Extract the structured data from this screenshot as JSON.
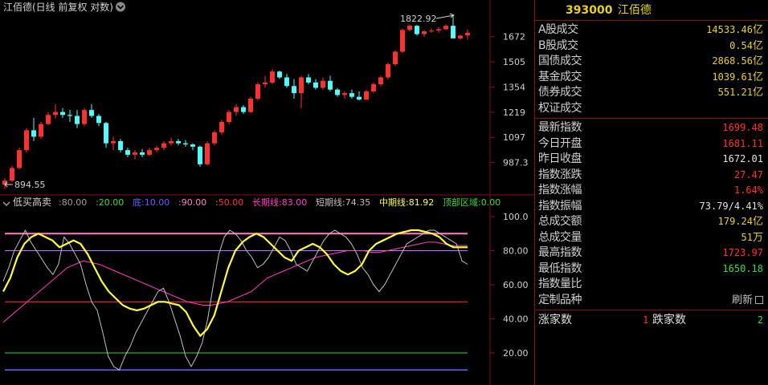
{
  "header": {
    "title": "江佰德(日线 前复权 对数)",
    "code": "393000",
    "name": "江佰德"
  },
  "main_chart": {
    "y_ticks": [
      "1672",
      "1505",
      "1354",
      "1219",
      "1097",
      "987.3"
    ],
    "max_label": "1822.92",
    "min_label": "894.55",
    "colors": {
      "up": "#ff3232",
      "down": "#54fcfc"
    },
    "candles": [
      {
        "o": 900,
        "h": 925,
        "l": 885,
        "c": 915
      },
      {
        "o": 915,
        "h": 975,
        "l": 910,
        "c": 965
      },
      {
        "o": 965,
        "h": 1050,
        "l": 960,
        "c": 1040
      },
      {
        "o": 1040,
        "h": 1140,
        "l": 1030,
        "c": 1130
      },
      {
        "o": 1130,
        "h": 1190,
        "l": 1080,
        "c": 1100
      },
      {
        "o": 1100,
        "h": 1170,
        "l": 1090,
        "c": 1160
      },
      {
        "o": 1160,
        "h": 1220,
        "l": 1155,
        "c": 1205
      },
      {
        "o": 1205,
        "h": 1260,
        "l": 1185,
        "c": 1220
      },
      {
        "o": 1220,
        "h": 1240,
        "l": 1190,
        "c": 1205
      },
      {
        "o": 1205,
        "h": 1230,
        "l": 1170,
        "c": 1200
      },
      {
        "o": 1200,
        "h": 1230,
        "l": 1140,
        "c": 1160
      },
      {
        "o": 1160,
        "h": 1240,
        "l": 1150,
        "c": 1230
      },
      {
        "o": 1230,
        "h": 1260,
        "l": 1190,
        "c": 1200
      },
      {
        "o": 1200,
        "h": 1210,
        "l": 1150,
        "c": 1165
      },
      {
        "o": 1165,
        "h": 1170,
        "l": 1050,
        "c": 1070
      },
      {
        "o": 1070,
        "h": 1100,
        "l": 1040,
        "c": 1080
      },
      {
        "o": 1080,
        "h": 1090,
        "l": 1030,
        "c": 1040
      },
      {
        "o": 1040,
        "h": 1050,
        "l": 1010,
        "c": 1020
      },
      {
        "o": 1020,
        "h": 1040,
        "l": 1000,
        "c": 1030
      },
      {
        "o": 1030,
        "h": 1045,
        "l": 1010,
        "c": 1020
      },
      {
        "o": 1020,
        "h": 1050,
        "l": 1015,
        "c": 1040
      },
      {
        "o": 1040,
        "h": 1060,
        "l": 1030,
        "c": 1050
      },
      {
        "o": 1050,
        "h": 1080,
        "l": 1040,
        "c": 1070
      },
      {
        "o": 1070,
        "h": 1095,
        "l": 1060,
        "c": 1080
      },
      {
        "o": 1080,
        "h": 1090,
        "l": 1060,
        "c": 1070
      },
      {
        "o": 1070,
        "h": 1085,
        "l": 1055,
        "c": 1065
      },
      {
        "o": 1065,
        "h": 1070,
        "l": 1040,
        "c": 1055
      },
      {
        "o": 1055,
        "h": 1060,
        "l": 970,
        "c": 980
      },
      {
        "o": 980,
        "h": 1080,
        "l": 975,
        "c": 1070
      },
      {
        "o": 1070,
        "h": 1130,
        "l": 1060,
        "c": 1120
      },
      {
        "o": 1120,
        "h": 1180,
        "l": 1110,
        "c": 1170
      },
      {
        "o": 1170,
        "h": 1230,
        "l": 1160,
        "c": 1220
      },
      {
        "o": 1220,
        "h": 1260,
        "l": 1200,
        "c": 1245
      },
      {
        "o": 1245,
        "h": 1255,
        "l": 1210,
        "c": 1220
      },
      {
        "o": 1220,
        "h": 1300,
        "l": 1215,
        "c": 1290
      },
      {
        "o": 1290,
        "h": 1380,
        "l": 1280,
        "c": 1370
      },
      {
        "o": 1370,
        "h": 1420,
        "l": 1350,
        "c": 1380
      },
      {
        "o": 1380,
        "h": 1460,
        "l": 1370,
        "c": 1445
      },
      {
        "o": 1445,
        "h": 1450,
        "l": 1400,
        "c": 1410
      },
      {
        "o": 1410,
        "h": 1430,
        "l": 1350,
        "c": 1360
      },
      {
        "o": 1360,
        "h": 1400,
        "l": 1290,
        "c": 1320
      },
      {
        "o": 1320,
        "h": 1420,
        "l": 1240,
        "c": 1410
      },
      {
        "o": 1410,
        "h": 1430,
        "l": 1370,
        "c": 1380
      },
      {
        "o": 1380,
        "h": 1400,
        "l": 1340,
        "c": 1350
      },
      {
        "o": 1350,
        "h": 1410,
        "l": 1340,
        "c": 1390
      },
      {
        "o": 1390,
        "h": 1420,
        "l": 1330,
        "c": 1340
      },
      {
        "o": 1340,
        "h": 1350,
        "l": 1300,
        "c": 1310
      },
      {
        "o": 1310,
        "h": 1330,
        "l": 1290,
        "c": 1320
      },
      {
        "o": 1320,
        "h": 1340,
        "l": 1290,
        "c": 1300
      },
      {
        "o": 1300,
        "h": 1330,
        "l": 1280,
        "c": 1285
      },
      {
        "o": 1285,
        "h": 1340,
        "l": 1280,
        "c": 1330
      },
      {
        "o": 1330,
        "h": 1380,
        "l": 1320,
        "c": 1370
      },
      {
        "o": 1370,
        "h": 1420,
        "l": 1360,
        "c": 1410
      },
      {
        "o": 1410,
        "h": 1500,
        "l": 1400,
        "c": 1490
      },
      {
        "o": 1490,
        "h": 1580,
        "l": 1480,
        "c": 1570
      },
      {
        "o": 1570,
        "h": 1730,
        "l": 1560,
        "c": 1720
      },
      {
        "o": 1720,
        "h": 1760,
        "l": 1710,
        "c": 1750
      },
      {
        "o": 1750,
        "h": 1755,
        "l": 1680,
        "c": 1690
      },
      {
        "o": 1690,
        "h": 1720,
        "l": 1670,
        "c": 1710
      },
      {
        "o": 1710,
        "h": 1730,
        "l": 1700,
        "c": 1715
      },
      {
        "o": 1715,
        "h": 1740,
        "l": 1700,
        "c": 1725
      },
      {
        "o": 1725,
        "h": 1760,
        "l": 1720,
        "c": 1750
      },
      {
        "o": 1750,
        "h": 1822.92,
        "l": 1745,
        "c": 1660
      },
      {
        "o": 1660,
        "h": 1685,
        "l": 1650,
        "c": 1680
      },
      {
        "o": 1681.11,
        "h": 1723.97,
        "l": 1650.18,
        "c": 1699.48
      }
    ]
  },
  "indicator": {
    "name": "低买高卖",
    "params": [
      {
        "value": "80.00",
        "color": "#a0a0a0"
      },
      {
        "value": "20.00",
        "color": "#3cdc3c"
      },
      {
        "label": "底",
        "value": "10.00",
        "color": "#6060ff"
      },
      {
        "value": "90.00",
        "color": "#ff80c0"
      },
      {
        "value": "50.00",
        "color": "#ff3232"
      },
      {
        "label": "长期线",
        "value": "83.00",
        "color": "#ff40c0"
      },
      {
        "label": "短期线",
        "value": "74.35",
        "color": "#c0c0c0"
      },
      {
        "label": "中期线",
        "value": "81.92",
        "color": "#ffff40"
      },
      {
        "label": "顶部区域",
        "value": "0.00",
        "color": "#3cdc3c"
      }
    ],
    "y_ticks": [
      "100.0",
      "80.00",
      "60.00",
      "40.00",
      "20.00"
    ],
    "short_line": [
      62,
      70,
      80,
      86,
      92,
      85,
      80,
      75,
      70,
      66,
      72,
      88,
      84,
      78,
      72,
      60,
      50,
      45,
      32,
      18,
      12,
      10,
      18,
      24,
      32,
      38,
      44,
      50,
      56,
      58,
      50,
      40,
      30,
      18,
      12,
      18,
      26,
      40,
      60,
      78,
      88,
      92,
      90,
      86,
      80,
      76,
      70,
      72,
      76,
      82,
      88,
      86,
      80,
      72,
      70,
      68,
      74,
      80,
      86,
      90,
      92,
      90,
      88,
      84,
      78,
      70,
      66,
      60,
      56,
      60,
      66,
      72,
      78,
      84,
      86,
      88,
      90,
      92,
      92,
      90,
      88,
      86,
      84,
      74,
      72
    ],
    "mid_line": [
      56,
      64,
      76,
      84,
      88,
      90,
      88,
      86,
      82,
      84,
      86,
      84,
      78,
      70,
      62,
      56,
      52,
      48,
      46,
      45,
      46,
      48,
      50,
      50,
      49,
      48,
      44,
      36,
      30,
      34,
      42,
      56,
      70,
      80,
      85,
      88,
      90,
      88,
      84,
      80,
      76,
      74,
      80,
      82,
      84,
      82,
      78,
      72,
      68,
      66,
      68,
      72,
      80,
      84,
      86,
      88,
      90,
      91,
      92,
      92,
      91,
      90,
      88,
      84,
      82,
      82,
      82
    ],
    "long_line": [
      38,
      42,
      46,
      50,
      54,
      58,
      62,
      66,
      70,
      72,
      74,
      73,
      72,
      70,
      68,
      66,
      64,
      62,
      60,
      58,
      56,
      54,
      52,
      50,
      49,
      48,
      48,
      49,
      50,
      52,
      54,
      56,
      60,
      64,
      66,
      68,
      70,
      72,
      74,
      76,
      77,
      78,
      79,
      80,
      80,
      80,
      79,
      79,
      80,
      81,
      82,
      83,
      84,
      85,
      85,
      84,
      83,
      83,
      83
    ]
  },
  "panel": {
    "section1": [
      {
        "label": "A股成交",
        "value": "14533.46",
        "unit": "亿",
        "color": "yel"
      },
      {
        "label": "B股成交",
        "value": "0.54",
        "unit": "亿",
        "color": "yel"
      },
      {
        "label": "国债成交",
        "value": "2868.56",
        "unit": "亿",
        "color": "yel"
      },
      {
        "label": "基金成交",
        "value": "1039.61",
        "unit": "亿",
        "color": "yel"
      },
      {
        "label": "债券成交",
        "value": "551.21",
        "unit": "亿",
        "color": "yel"
      },
      {
        "label": "权证成交",
        "value": "",
        "unit": "",
        "color": "yel"
      }
    ],
    "section2": [
      {
        "label": "最新指数",
        "value": "1699.48",
        "unit": "",
        "color": "red"
      },
      {
        "label": "今日开盘",
        "value": "1681.11",
        "unit": "",
        "color": "red"
      },
      {
        "label": "昨日收盘",
        "value": "1672.01",
        "unit": "",
        "color": "wht"
      },
      {
        "label": "指数涨跌",
        "value": "27.47",
        "unit": "",
        "color": "red"
      },
      {
        "label": "指数涨幅",
        "value": "1.64%",
        "unit": "",
        "color": "red"
      },
      {
        "label": "指数振幅",
        "value": "73.79/4.41%",
        "unit": "",
        "color": "wht"
      },
      {
        "label": "总成交额",
        "value": "179.24",
        "unit": "亿",
        "color": "yel"
      },
      {
        "label": "总成交量",
        "value": "51",
        "unit": "万",
        "color": "yel"
      },
      {
        "label": "最高指数",
        "value": "1723.97",
        "unit": "",
        "color": "red"
      },
      {
        "label": "最低指数",
        "value": "1650.18",
        "unit": "",
        "color": "grn"
      },
      {
        "label": "指数量比",
        "value": "",
        "unit": "",
        "color": "wht"
      },
      {
        "label": "定制品种",
        "value": "",
        "unit": "",
        "color": "wht"
      }
    ],
    "refresh_label": "刷新",
    "bottom": {
      "up_label": "涨家数",
      "up_value": "1",
      "down_label": "跌家数",
      "down_value": "2"
    }
  }
}
